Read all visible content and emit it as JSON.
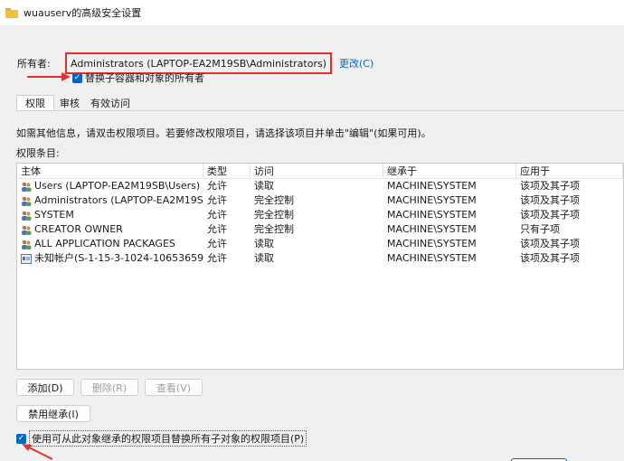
{
  "window": {
    "title": "wuauserv的高级安全设置"
  },
  "owner": {
    "label": "所有者:",
    "value": "Administrators (LAPTOP-EA2M19SB\\Administrators)",
    "change_link": "更改(C)"
  },
  "replace_owner": {
    "checked": true,
    "label": "替换子容器和对象的所有者"
  },
  "tabs": [
    {
      "label": "权限",
      "active": true
    },
    {
      "label": "审核",
      "active": false
    },
    {
      "label": "有效访问",
      "active": false
    }
  ],
  "info_text": "如需其他信息，请双击权限项目。若要修改权限项目，请选择该项目并单击\"编辑\"(如果可用)。",
  "permission_entries_label": "权限条目:",
  "table": {
    "headers": [
      "主体",
      "类型",
      "访问",
      "继承于",
      "应用于"
    ],
    "rows": [
      {
        "icon": "users-icon",
        "principal": "Users (LAPTOP-EA2M19SB\\Users)",
        "type": "允许",
        "access": "读取",
        "inherited_from": "MACHINE\\SYSTEM",
        "applies_to": "该项及其子项"
      },
      {
        "icon": "users-icon",
        "principal": "Administrators (LAPTOP-EA2M19SB...",
        "type": "允许",
        "access": "完全控制",
        "inherited_from": "MACHINE\\SYSTEM",
        "applies_to": "该项及其子项"
      },
      {
        "icon": "users-icon",
        "principal": "SYSTEM",
        "type": "允许",
        "access": "完全控制",
        "inherited_from": "MACHINE\\SYSTEM",
        "applies_to": "该项及其子项"
      },
      {
        "icon": "users-icon",
        "principal": "CREATOR OWNER",
        "type": "允许",
        "access": "完全控制",
        "inherited_from": "MACHINE\\SYSTEM",
        "applies_to": "只有子项"
      },
      {
        "icon": "users-icon",
        "principal": "ALL APPLICATION PACKAGES",
        "type": "允许",
        "access": "读取",
        "inherited_from": "MACHINE\\SYSTEM",
        "applies_to": "该项及其子项"
      },
      {
        "icon": "unknown-account-icon",
        "principal": "未知帐户(S-1-15-3-1024-106536593...",
        "type": "允许",
        "access": "读取",
        "inherited_from": "MACHINE\\SYSTEM",
        "applies_to": "该项及其子项"
      }
    ]
  },
  "buttons": {
    "add": "添加(D)",
    "remove": "删除(R)",
    "view": "查看(V)",
    "disable_inheritance": "禁用继承(I)"
  },
  "replace_child_permissions": {
    "checked": true,
    "label": "使用可从此对象继承的权限项目替换所有子对象的权限项目(P)"
  },
  "colors": {
    "accent": "#0067c0",
    "highlight_border": "#e53030",
    "link": "#0066cc"
  }
}
